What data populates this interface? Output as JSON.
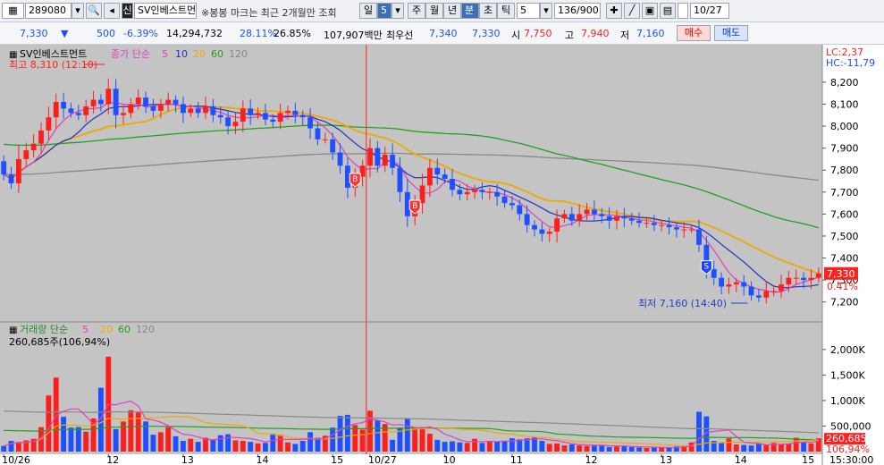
{
  "toolbar": {
    "code": "289080",
    "market_badge": "신",
    "stock_name": "SV인베스트먼",
    "notice": "※봉봉 마크는 최근 2개월만 조회",
    "periods": [
      "일",
      "5",
      "주",
      "월",
      "년",
      "분",
      "초",
      "틱"
    ],
    "active_period": "분",
    "interval": "5",
    "count": "136/900",
    "date": "10/27"
  },
  "quote": {
    "price": "7,330",
    "change": "500",
    "pct": "-6.39%",
    "volume": "14,294,732",
    "turnover_rate": "28.11%",
    "ratio": "26.85%",
    "amount": "107,907백만",
    "pref_label": "최우선",
    "ask": "7,340",
    "bid": "7,330",
    "open_label": "시",
    "open": "7,750",
    "high_label": "고",
    "high": "7,940",
    "low_label": "저",
    "low": "7,160",
    "buy": "매수",
    "sell": "매도"
  },
  "colors": {
    "up": "#ff1e1e",
    "down": "#1e50ff",
    "ma5": "#e040c0",
    "ma10": "#2030c0",
    "ma20": "#f0a800",
    "ma60": "#20a020",
    "ma120": "#888888",
    "bg": "#c4c4c4"
  },
  "chart_data": {
    "type": "candlestick",
    "title": "SV인베스트먼트",
    "legend_price": {
      "label": "종가 단순",
      "periods": [
        "5",
        "10",
        "20",
        "60",
        "120"
      ]
    },
    "legend_volume": {
      "label": "거래량 단순",
      "periods": [
        "5",
        "20",
        "60",
        "120"
      ]
    },
    "volume_label": "260,685주(106,94%)",
    "y_price_ticks": [
      8200,
      8100,
      8000,
      7900,
      7800,
      7700,
      7600,
      7500,
      7400,
      7300,
      7200
    ],
    "y_price_range": [
      7150,
      8350
    ],
    "y_volume_ticks": [
      "2,000K",
      "1,500K",
      "1,000K",
      "500,000"
    ],
    "y_volume_max": 2400000,
    "x_labels": [
      {
        "i": 0,
        "t": "10/26"
      },
      {
        "i": 14,
        "t": "12"
      },
      {
        "i": 24,
        "t": "13"
      },
      {
        "i": 34,
        "t": "14"
      },
      {
        "i": 44,
        "t": "15"
      },
      {
        "i": 49,
        "t": "10/27"
      },
      {
        "i": 59,
        "t": "10"
      },
      {
        "i": 68,
        "t": "11"
      },
      {
        "i": 78,
        "t": "12"
      },
      {
        "i": 88,
        "t": "13"
      },
      {
        "i": 98,
        "t": "14"
      },
      {
        "i": 107,
        "t": "15"
      }
    ],
    "time_label": "15:30:00",
    "lc": "LC:2,37",
    "hc": "HC:-11,79",
    "last_price": "7,330",
    "last_pct": "0.41%",
    "last_volume": "260,685",
    "last_vol_pct": "106,94%",
    "high_annotation": "최고 8,310 (12:10)",
    "low_annotation": "최저 7,160 (14:40)",
    "signals": [
      {
        "i": 47,
        "t": "B"
      },
      {
        "i": 55,
        "t": "B"
      },
      {
        "i": 94,
        "t": "S"
      }
    ],
    "day_split_index": 48.5,
    "close": [
      7780,
      7740,
      7850,
      7890,
      7920,
      7980,
      8040,
      8110,
      8080,
      8060,
      8050,
      8090,
      8120,
      8100,
      8170,
      8050,
      8060,
      8100,
      8130,
      8090,
      8070,
      8100,
      8120,
      8100,
      8060,
      8080,
      8060,
      8090,
      8050,
      8040,
      8000,
      8020,
      8080,
      8050,
      8060,
      8030,
      8020,
      8060,
      8070,
      8050,
      8040,
      7990,
      7940,
      7940,
      7880,
      7820,
      7720,
      7770,
      7820,
      7900,
      7820,
      7870,
      7810,
      7700,
      7590,
      7650,
      7730,
      7810,
      7780,
      7760,
      7710,
      7690,
      7700,
      7710,
      7700,
      7700,
      7680,
      7650,
      7640,
      7600,
      7550,
      7530,
      7510,
      7520,
      7580,
      7600,
      7570,
      7600,
      7620,
      7600,
      7590,
      7570,
      7590,
      7580,
      7570,
      7560,
      7560,
      7550,
      7550,
      7540,
      7530,
      7530,
      7530,
      7460,
      7350,
      7310,
      7270,
      7280,
      7290,
      7270,
      7230,
      7220,
      7250,
      7250,
      7280,
      7310,
      7310,
      7300,
      7310,
      7330
    ],
    "volume": [
      110000,
      210000,
      190000,
      220000,
      250000,
      480000,
      1100000,
      1450000,
      680000,
      470000,
      480000,
      390000,
      650000,
      1250000,
      1860000,
      440000,
      590000,
      810000,
      770000,
      590000,
      330000,
      380000,
      480000,
      300000,
      210000,
      250000,
      190000,
      270000,
      230000,
      320000,
      340000,
      220000,
      210000,
      190000,
      160000,
      170000,
      350000,
      330000,
      180000,
      150000,
      210000,
      380000,
      270000,
      310000,
      470000,
      700000,
      720000,
      520000,
      430000,
      800000,
      610000,
      540000,
      230000,
      470000,
      650000,
      470000,
      480000,
      350000,
      230000,
      190000,
      200000,
      180000,
      170000,
      250000,
      170000,
      210000,
      190000,
      200000,
      260000,
      240000,
      260000,
      280000,
      210000,
      150000,
      160000,
      120000,
      140000,
      120000,
      110000,
      130000,
      120000,
      90000,
      100000,
      110000,
      90000,
      80000,
      70000,
      80000,
      90000,
      70000,
      100000,
      110000,
      180000,
      780000,
      690000,
      210000,
      180000,
      260000,
      140000,
      130000,
      120000,
      150000,
      130000,
      170000,
      150000,
      150000,
      270000,
      190000,
      160000,
      260000
    ]
  }
}
